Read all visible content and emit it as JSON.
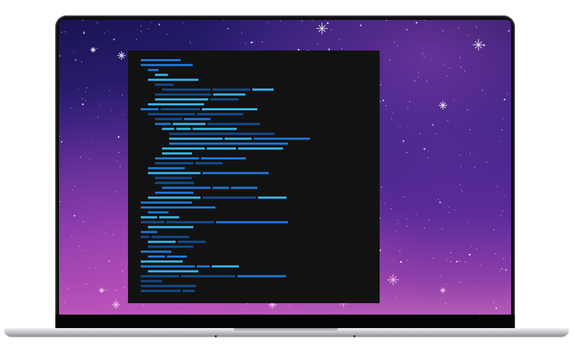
{
  "scene": {
    "subject": "laptop-mockup",
    "wallpaper": "starry-purple-night-sky",
    "colors": {
      "screen_top": "#1a1450",
      "screen_bottom": "#b45cb6",
      "terminal_bg": "#121212",
      "code_dark": "#124e8f",
      "code_mid": "#1e78d6",
      "code_light": "#39b6ee",
      "bezel": "#0d0d0f",
      "base": "#c7c7cc"
    }
  }
}
